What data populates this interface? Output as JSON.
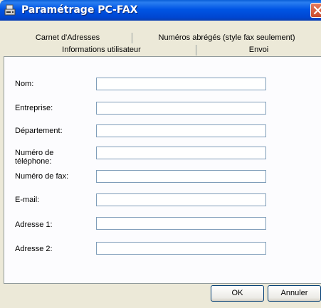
{
  "window": {
    "title": "Paramétrage PC-FAX"
  },
  "tabs_back": [
    "Carnet d'Adresses",
    "Numéros abrégés (style fax seulement)"
  ],
  "tabs_front": [
    "Informations utilisateur",
    "Envoi"
  ],
  "fields": [
    {
      "label": "Nom:",
      "value": ""
    },
    {
      "label": "Entreprise:",
      "value": ""
    },
    {
      "label": "Département:",
      "value": ""
    },
    {
      "label": "Numéro de",
      "label2": "téléphone:",
      "value": ""
    },
    {
      "label": "Numéro de fax:",
      "value": ""
    },
    {
      "label": "E-mail:",
      "value": ""
    },
    {
      "label": "Adresse 1:",
      "value": ""
    },
    {
      "label": "Adresse 2:",
      "value": ""
    }
  ],
  "buttons": {
    "ok": "OK",
    "cancel": "Annuler"
  }
}
